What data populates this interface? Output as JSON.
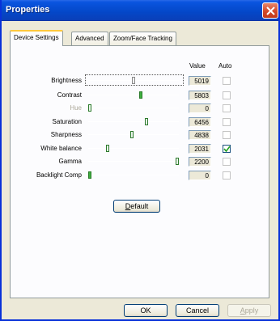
{
  "window": {
    "title": "Properties"
  },
  "tabs": [
    {
      "label": "Device Settings",
      "active": true
    },
    {
      "label": "Advanced",
      "active": false
    },
    {
      "label": "Zoom/Face Tracking",
      "active": false
    }
  ],
  "headers": {
    "value": "Value",
    "auto": "Auto"
  },
  "settings": [
    {
      "label": "Brightness",
      "value": "5019",
      "auto": false,
      "enabled": true,
      "position": 0.5
    },
    {
      "label": "Contrast",
      "value": "5803",
      "auto": false,
      "enabled": true,
      "position": 0.58
    },
    {
      "label": "Hue",
      "value": "0",
      "auto": false,
      "enabled": false,
      "position": 0.0
    },
    {
      "label": "Saturation",
      "value": "6456",
      "auto": false,
      "enabled": true,
      "position": 0.645
    },
    {
      "label": "Sharpness",
      "value": "4838",
      "auto": false,
      "enabled": true,
      "position": 0.48
    },
    {
      "label": "White balance",
      "value": "2031",
      "auto": true,
      "enabled": true,
      "position": 0.2
    },
    {
      "label": "Gamma",
      "value": "2200",
      "auto": false,
      "enabled": true,
      "position": 1.0
    },
    {
      "label": "Backlight Comp",
      "value": "0",
      "auto": false,
      "enabled": true,
      "position": 0.0
    }
  ],
  "buttons": {
    "default_prefix": "D",
    "default_rest": "efault",
    "ok": "OK",
    "cancel": "Cancel",
    "apply_prefix": "A",
    "apply_rest": "pply"
  }
}
